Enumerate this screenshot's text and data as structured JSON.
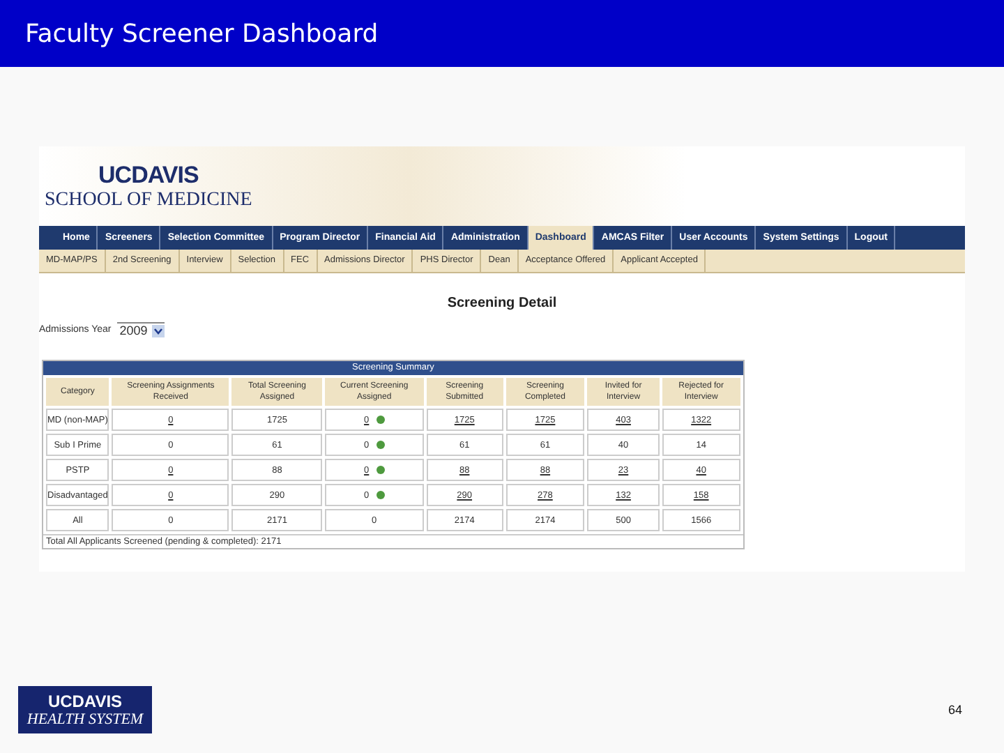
{
  "slide": {
    "title": "Faculty Screener Dashboard",
    "page_number": "64"
  },
  "site": {
    "logo_top": "UCDAVIS",
    "logo_bottom": "SCHOOL OF MEDICINE",
    "nav": [
      {
        "label": "Home",
        "selected": false
      },
      {
        "label": "Screeners",
        "selected": false
      },
      {
        "label": "Selection Committee",
        "selected": false
      },
      {
        "label": "Program Director",
        "selected": false
      },
      {
        "label": "Financial Aid",
        "selected": false
      },
      {
        "label": "Administration",
        "selected": false
      },
      {
        "label": "Dashboard",
        "selected": true
      },
      {
        "label": "AMCAS Filter",
        "selected": false
      },
      {
        "label": "User Accounts",
        "selected": false
      },
      {
        "label": "System Settings",
        "selected": false
      },
      {
        "label": "Logout",
        "selected": false
      }
    ],
    "subnav": [
      "MD-MAP/PS",
      "2nd Screening",
      "Interview",
      "Selection",
      "FEC",
      "Admissions Director",
      "PHS Director",
      "Dean",
      "Acceptance Offered",
      "Applicant Accepted"
    ],
    "heading": "Screening Detail",
    "year_label": "Admissions Year",
    "year_value": "2009",
    "table": {
      "title": "Screening Summary",
      "columns": [
        "Category",
        "Screening Assignments Received",
        "Total Screening Assigned",
        "Current Screening Assigned",
        "Screening Submitted",
        "Screening Completed",
        "Invited for Interview",
        "Rejected for Interview"
      ],
      "rows": [
        {
          "color": "#4e9a3e",
          "cells": [
            {
              "text": "MD (non-MAP)",
              "link": false
            },
            {
              "text": "0",
              "link": true
            },
            {
              "text": "1725",
              "link": false
            },
            {
              "text": "0",
              "link": true
            },
            {
              "text": "1725",
              "link": true
            },
            {
              "text": "1725",
              "link": true
            },
            {
              "text": "403",
              "link": true
            },
            {
              "text": "1322",
              "link": true
            }
          ]
        },
        {
          "color": "#4e9a3e",
          "cells": [
            {
              "text": "Sub I Prime",
              "link": false
            },
            {
              "text": "0",
              "link": false
            },
            {
              "text": "61",
              "link": false
            },
            {
              "text": "0",
              "link": false
            },
            {
              "text": "61",
              "link": false
            },
            {
              "text": "61",
              "link": false
            },
            {
              "text": "40",
              "link": false
            },
            {
              "text": "14",
              "link": false
            }
          ]
        },
        {
          "color": "#4e9a3e",
          "cells": [
            {
              "text": "PSTP",
              "link": false
            },
            {
              "text": "0",
              "link": true
            },
            {
              "text": "88",
              "link": false
            },
            {
              "text": "0",
              "link": true
            },
            {
              "text": "88",
              "link": true
            },
            {
              "text": "88",
              "link": true
            },
            {
              "text": "23",
              "link": true
            },
            {
              "text": "40",
              "link": true
            }
          ]
        },
        {
          "color": "#4e9a3e",
          "cells": [
            {
              "text": "Disadvantaged",
              "link": false
            },
            {
              "text": "0",
              "link": true
            },
            {
              "text": "290",
              "link": false
            },
            {
              "text": "0",
              "link": false
            },
            {
              "text": "290",
              "link": true
            },
            {
              "text": "278",
              "link": true
            },
            {
              "text": "132",
              "link": true
            },
            {
              "text": "158",
              "link": true
            }
          ]
        },
        {
          "cells": [
            {
              "text": "All",
              "link": false
            },
            {
              "text": "0",
              "link": false
            },
            {
              "text": "2171",
              "link": false
            },
            {
              "text": "0",
              "link": false
            },
            {
              "text": "2174",
              "link": false
            },
            {
              "text": "2174",
              "link": false
            },
            {
              "text": "500",
              "link": false
            },
            {
              "text": "1566",
              "link": false
            }
          ]
        }
      ],
      "footer": "Total All Applicants Screened (pending & completed): 2171"
    }
  },
  "footer_logo": {
    "top": "UCDAVIS",
    "bottom": "HEALTH SYSTEM"
  }
}
